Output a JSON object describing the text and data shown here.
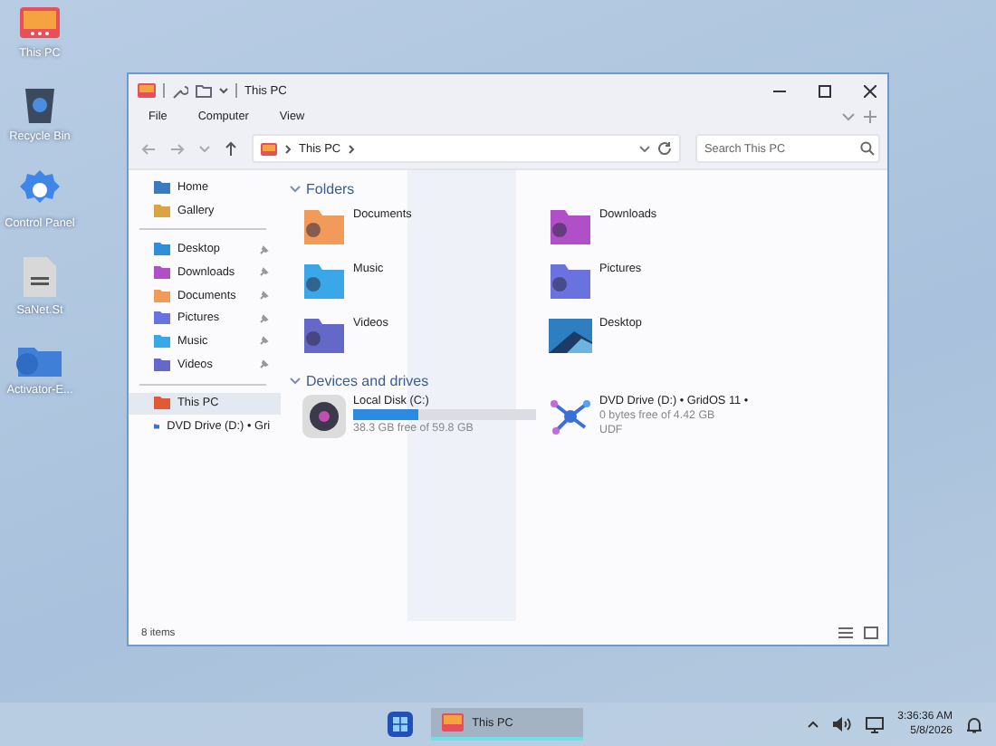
{
  "desktop_icons": [
    {
      "label": "This PC",
      "kind": "pc"
    },
    {
      "label": "Recycle Bin",
      "kind": "bin"
    },
    {
      "label": "Control Panel",
      "kind": "gear"
    },
    {
      "label": "SaNet.St",
      "kind": "file"
    },
    {
      "label": "Activator-E...",
      "kind": "folder"
    }
  ],
  "window": {
    "title": "This PC",
    "menu": [
      "File",
      "Computer",
      "View"
    ],
    "address": {
      "crumbs": [
        "This PC"
      ]
    },
    "search": {
      "placeholder": "Search This PC"
    },
    "sidebar": {
      "groups": [
        [
          {
            "label": "Home",
            "color": "#3a7bbf",
            "pinned": false,
            "selected": false
          },
          {
            "label": "Gallery",
            "color": "#d9a441",
            "pinned": false,
            "selected": false
          }
        ],
        [
          {
            "label": "Desktop",
            "color": "#2f8fd8",
            "pinned": true,
            "selected": false
          },
          {
            "label": "Downloads",
            "color": "#b04fc8",
            "pinned": true,
            "selected": false
          },
          {
            "label": "Documents",
            "color": "#f29a5a",
            "pinned": true,
            "selected": false
          },
          {
            "label": "Pictures",
            "color": "#6a72e0",
            "pinned": true,
            "selected": false
          },
          {
            "label": "Music",
            "color": "#3aa7e8",
            "pinned": true,
            "selected": false
          },
          {
            "label": "Videos",
            "color": "#6468c8",
            "pinned": true,
            "selected": false
          }
        ],
        [
          {
            "label": "This PC",
            "color": "#e05a3a",
            "pinned": false,
            "selected": true
          },
          {
            "label": "DVD Drive (D:) • Gri",
            "color": "#3b6fd8",
            "pinned": false,
            "selected": false
          }
        ]
      ]
    },
    "sections": [
      {
        "title": "Folders",
        "expanded": true,
        "kind": "folders",
        "items": [
          {
            "label": "Documents",
            "kind": "folder",
            "color": "#f29a5a"
          },
          {
            "label": "Downloads",
            "kind": "folder",
            "color": "#b04fc8"
          },
          {
            "label": "Music",
            "kind": "folder",
            "color": "#3aa7e8"
          },
          {
            "label": "Pictures",
            "kind": "folder",
            "color": "#6a72e0"
          },
          {
            "label": "Videos",
            "kind": "folder",
            "color": "#6468c8"
          },
          {
            "label": "Desktop",
            "kind": "image",
            "color": "#2f7fc0"
          }
        ]
      },
      {
        "title": "Devices and drives",
        "expanded": true,
        "kind": "drives",
        "items": [
          {
            "label": "Local Disk (C:)",
            "kind": "disk",
            "level": 0.36,
            "detail": "38.3 GB free of 59.8 GB"
          },
          {
            "label": "DVD Drive (D:) • GridOS 11 •",
            "kind": "dvd",
            "detail": "0 bytes free of 4.42 GB",
            "extra": "UDF"
          }
        ]
      }
    ],
    "status_bar": {
      "count": "8 items"
    }
  },
  "taskbar": {
    "apps": [
      {
        "label": "This PC",
        "selected": true
      }
    ],
    "time": "3:36:36 AM",
    "date": "5/8/2026"
  }
}
